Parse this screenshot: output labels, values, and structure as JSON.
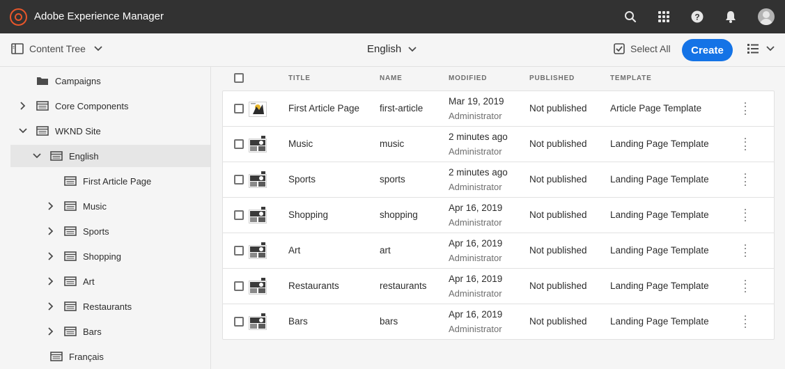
{
  "header": {
    "app_title": "Adobe Experience Manager",
    "icons": [
      "search-icon",
      "apps-icon",
      "help-icon",
      "notifications-icon",
      "user-avatar"
    ]
  },
  "actionbar": {
    "rail_toggle_label": "Content Tree",
    "language_label": "English",
    "select_all_label": "Select All",
    "create_label": "Create",
    "accent_color": "#1473e6"
  },
  "tree": {
    "items": [
      {
        "label": "Campaigns",
        "icon": "folder-icon",
        "expand": "none",
        "level": 0
      },
      {
        "label": "Core Components",
        "icon": "page-icon",
        "expand": "collapsed",
        "level": 0
      },
      {
        "label": "WKND Site",
        "icon": "page-icon",
        "expand": "expanded",
        "level": 0
      },
      {
        "label": "English",
        "icon": "page-icon",
        "expand": "expanded",
        "level": 1,
        "selected": true
      },
      {
        "label": "First Article Page",
        "icon": "page-icon",
        "expand": "none",
        "level": 2
      },
      {
        "label": "Music",
        "icon": "page-icon",
        "expand": "collapsed",
        "level": 2
      },
      {
        "label": "Sports",
        "icon": "page-icon",
        "expand": "collapsed",
        "level": 2
      },
      {
        "label": "Shopping",
        "icon": "page-icon",
        "expand": "collapsed",
        "level": 2
      },
      {
        "label": "Art",
        "icon": "page-icon",
        "expand": "collapsed",
        "level": 2
      },
      {
        "label": "Restaurants",
        "icon": "page-icon",
        "expand": "collapsed",
        "level": 2
      },
      {
        "label": "Bars",
        "icon": "page-icon",
        "expand": "collapsed",
        "level": 2
      },
      {
        "label": "Français",
        "icon": "page-icon",
        "expand": "none",
        "level": 1
      }
    ]
  },
  "table": {
    "columns": [
      "TITLE",
      "NAME",
      "MODIFIED",
      "PUBLISHED",
      "TEMPLATE"
    ],
    "rows": [
      {
        "title": "First Article Page",
        "name": "first-article",
        "modified": "Mar 19, 2019",
        "modified_by": "Administrator",
        "published": "Not published",
        "template": "Article Page Template",
        "thumb": "article"
      },
      {
        "title": "Music",
        "name": "music",
        "modified": "2 minutes ago",
        "modified_by": "Administrator",
        "published": "Not published",
        "template": "Landing Page Template",
        "thumb": "landing"
      },
      {
        "title": "Sports",
        "name": "sports",
        "modified": "2 minutes ago",
        "modified_by": "Administrator",
        "published": "Not published",
        "template": "Landing Page Template",
        "thumb": "landing"
      },
      {
        "title": "Shopping",
        "name": "shopping",
        "modified": "Apr 16, 2019",
        "modified_by": "Administrator",
        "published": "Not published",
        "template": "Landing Page Template",
        "thumb": "landing"
      },
      {
        "title": "Art",
        "name": "art",
        "modified": "Apr 16, 2019",
        "modified_by": "Administrator",
        "published": "Not published",
        "template": "Landing Page Template",
        "thumb": "landing"
      },
      {
        "title": "Restaurants",
        "name": "restaurants",
        "modified": "Apr 16, 2019",
        "modified_by": "Administrator",
        "published": "Not published",
        "template": "Landing Page Template",
        "thumb": "landing"
      },
      {
        "title": "Bars",
        "name": "bars",
        "modified": "Apr 16, 2019",
        "modified_by": "Administrator",
        "published": "Not published",
        "template": "Landing Page Template",
        "thumb": "landing"
      }
    ]
  }
}
